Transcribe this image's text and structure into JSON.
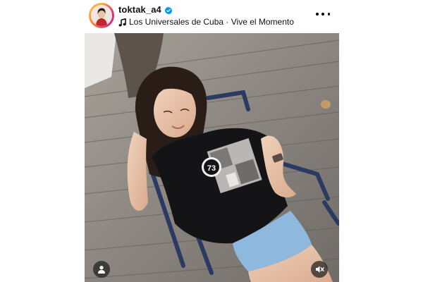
{
  "post": {
    "username": "toktak_a4",
    "verified": true,
    "audio": {
      "artist": "Los Universales de Cuba",
      "separator": " · ",
      "title": "Vive el Momento"
    },
    "icons": {
      "verified": "verified-badge-icon",
      "music": "music-note-icon",
      "more": "more-options-icon",
      "tagged_people": "user-tag-icon",
      "audio_muted": "speaker-muted-icon"
    },
    "media": {
      "shirt_print": "73"
    },
    "colors": {
      "verified_blue": "#0095f6",
      "text": "#111111",
      "overlay_button": "#1e1e1e"
    }
  }
}
